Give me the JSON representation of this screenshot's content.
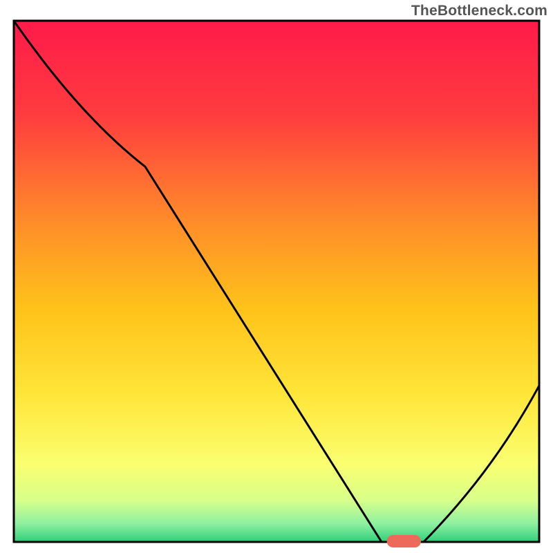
{
  "watermark": "TheBottleneck.com",
  "chart_data": {
    "type": "line",
    "title": "",
    "xlabel": "",
    "ylabel": "",
    "xlim": [
      0,
      100
    ],
    "ylim": [
      0,
      100
    ],
    "series": [
      {
        "name": "bottleneck-curve",
        "x": [
          0,
          25,
          70,
          78,
          100
        ],
        "y": [
          100,
          72,
          0,
          0,
          30
        ]
      }
    ],
    "marker": {
      "name": "optimal-zone",
      "x_start": 71,
      "x_end": 77.5,
      "y": 0,
      "color": "#ed6a5a"
    },
    "gradient_stops": [
      {
        "offset": 0.0,
        "color": "#ff1a4a"
      },
      {
        "offset": 0.18,
        "color": "#ff3c3f"
      },
      {
        "offset": 0.38,
        "color": "#ff8a2a"
      },
      {
        "offset": 0.55,
        "color": "#ffc21a"
      },
      {
        "offset": 0.72,
        "color": "#ffe63a"
      },
      {
        "offset": 0.85,
        "color": "#faff70"
      },
      {
        "offset": 0.92,
        "color": "#d8ff8a"
      },
      {
        "offset": 0.965,
        "color": "#8ef0a0"
      },
      {
        "offset": 1.0,
        "color": "#2ecf7a"
      }
    ],
    "frame_color": "#000000",
    "curve_color": "#000000",
    "curve_width": 3
  }
}
